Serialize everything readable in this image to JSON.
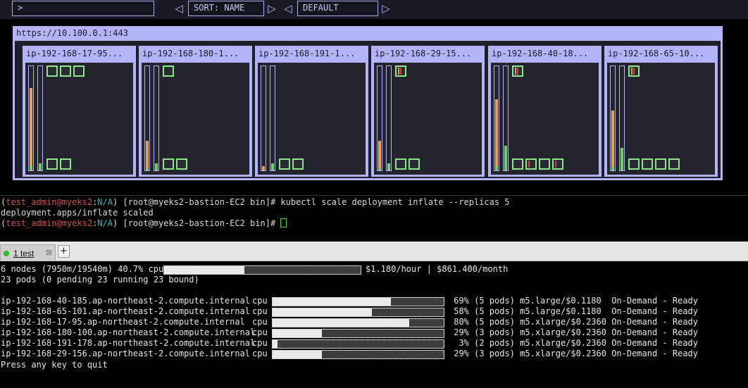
{
  "dashboard": {
    "filter_value": ">",
    "sort_label": "SORT: NAME",
    "theme_label": "DEFAULT",
    "cluster_url": "https://10.100.0.1:443",
    "nodes": [
      {
        "label": "ip-192-168-17-95...",
        "cpu_fraction": 0.8,
        "mem_fraction": 0.07,
        "top_pods": [
          {
            "bars": []
          },
          {
            "bars": []
          },
          {
            "bars": []
          }
        ],
        "bottom_pods": [
          {
            "bars": []
          },
          {
            "bars": []
          }
        ]
      },
      {
        "label": "ip-192-168-180-1...",
        "cpu_fraction": 0.29,
        "mem_fraction": 0.07,
        "top_pods": [
          {
            "bars": []
          }
        ],
        "bottom_pods": [
          {
            "bars": []
          },
          {
            "bars": []
          }
        ]
      },
      {
        "label": "ip-192-168-191-1...",
        "cpu_fraction": 0.04,
        "mem_fraction": 0.07,
        "top_pods": [],
        "bottom_pods": [
          {
            "bars": []
          },
          {
            "bars": []
          }
        ]
      },
      {
        "label": "ip-192-168-29-15...",
        "cpu_fraction": 0.29,
        "mem_fraction": 0.07,
        "top_pods": [
          {
            "bars": [
              "#e0a050",
              "#d04040"
            ]
          }
        ],
        "bottom_pods": [
          {
            "bars": []
          },
          {
            "bars": []
          }
        ]
      },
      {
        "label": "ip-192-168-40-18...",
        "cpu_fraction": 0.69,
        "mem_fraction": 0.24,
        "top_pods": [
          {
            "bars": [
              "#e0a050",
              "#d04040"
            ]
          }
        ],
        "bottom_pods": [
          {
            "bars": []
          },
          {
            "bars": [
              "#d04040"
            ]
          },
          {
            "bars": []
          },
          {
            "bars": [
              "#d04040"
            ]
          }
        ]
      },
      {
        "label": "ip-192-168-65-10...",
        "cpu_fraction": 0.58,
        "mem_fraction": 0.22,
        "top_pods": [
          {
            "bars": [
              "#e0a050",
              "#d04040"
            ]
          }
        ],
        "bottom_pods": [
          {
            "bars": []
          },
          {
            "bars": []
          },
          {
            "bars": []
          },
          {
            "bars": []
          }
        ]
      }
    ]
  },
  "terminal": {
    "user": "test_admin@myeks2",
    "ns": "N/A",
    "prompt_host": " [root@myeks2-bastion-EC2 bin]# ",
    "command": "kubectl scale deployment inflate --replicas 5",
    "output": "deployment.apps/inflate scaled"
  },
  "tabbar": {
    "tab_label": "1 test",
    "close_glyph": "⊠",
    "add_glyph": "+"
  },
  "viewer": {
    "summary_line_prefix": "6 nodes (7950m/19540m) 40.7% cpu",
    "summary_fraction": 0.407,
    "summary_cost": "$1.180/hour | $861.400/month",
    "pods_line": "23 pods (0 pending 23 running 23 bound)",
    "resource_label": "cpu",
    "nodes": [
      {
        "name": "ip-192-168-40-185.ap-northeast-2.compute.internal",
        "fraction": 0.69,
        "detail": " 69% (5 pods) m5.large/$0.1180  On-Demand - Ready"
      },
      {
        "name": "ip-192-168-65-101.ap-northeast-2.compute.internal",
        "fraction": 0.58,
        "detail": " 58% (5 pods) m5.large/$0.1180  On-Demand - Ready"
      },
      {
        "name": "ip-192-168-17-95.ap-northeast-2.compute.internal",
        "fraction": 0.8,
        "detail": " 80% (5 pods) m5.xlarge/$0.2360 On-Demand - Ready"
      },
      {
        "name": "ip-192-168-180-100.ap-northeast-2.compute.internal",
        "fraction": 0.29,
        "detail": " 29% (3 pods) m5.xlarge/$0.2360 On-Demand - Ready"
      },
      {
        "name": "ip-192-168-191-178.ap-northeast-2.compute.internal",
        "fraction": 0.03,
        "detail": "  3% (2 pods) m5.xlarge/$0.2360 On-Demand - Ready"
      },
      {
        "name": "ip-192-168-29-156.ap-northeast-2.compute.internal",
        "fraction": 0.29,
        "detail": " 29% (3 pods) m5.xlarge/$0.2360 On-Demand - Ready"
      }
    ],
    "quit_hint": "Press any key to quit"
  }
}
